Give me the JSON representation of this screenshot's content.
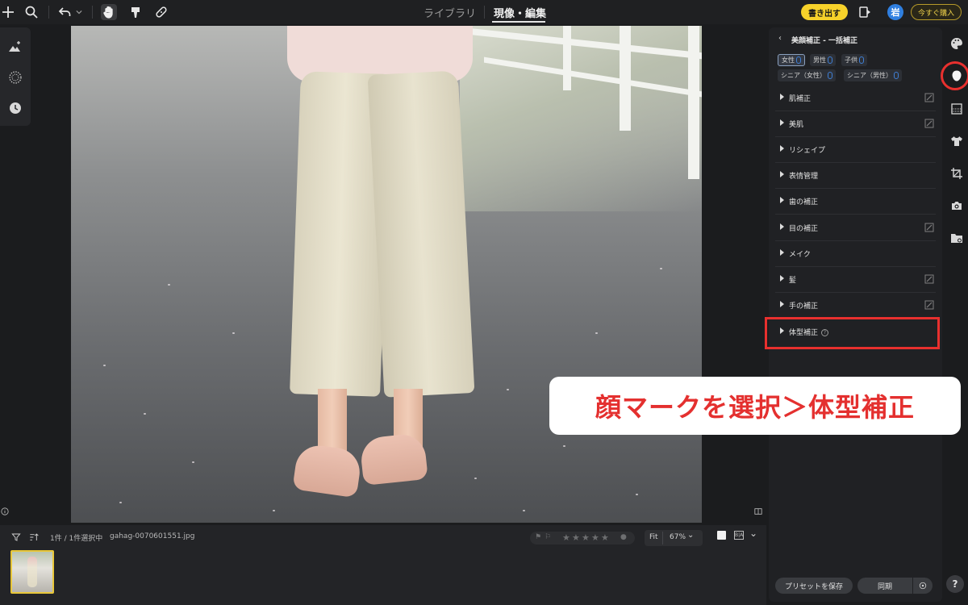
{
  "header": {
    "tabs": [
      {
        "label": "ライブラリ",
        "active": false
      },
      {
        "label": "現像・編集",
        "active": true
      }
    ],
    "export_label": "書き出す",
    "avatar_initial": "岩",
    "buy_label": "今すぐ購入"
  },
  "left_tools": [
    "mountain-adjust-icon",
    "noise-reduction-icon",
    "history-icon"
  ],
  "right_rail_icons": [
    "palette-icon",
    "face-icon",
    "gradient-icon",
    "clothing-icon",
    "crop-icon",
    "camera-icon",
    "folder-icon"
  ],
  "panel": {
    "title": "美顔補正 - 一括補正",
    "chips": [
      {
        "label": "女性",
        "selected": true
      },
      {
        "label": "男性",
        "selected": false
      },
      {
        "label": "子供",
        "selected": false
      },
      {
        "label": "シニア（女性）",
        "selected": false
      },
      {
        "label": "シニア（男性）",
        "selected": false
      }
    ],
    "sections": [
      {
        "label": "肌補正",
        "editable": true
      },
      {
        "label": "美肌",
        "editable": true
      },
      {
        "label": "リシェイプ",
        "editable": false
      },
      {
        "label": "表情管理",
        "editable": false
      },
      {
        "label": "歯の補正",
        "editable": false
      },
      {
        "label": "目の補正",
        "editable": true
      },
      {
        "label": "メイク",
        "editable": false
      },
      {
        "label": "髪",
        "editable": true
      },
      {
        "label": "手の補正",
        "editable": true
      },
      {
        "label": "体型補正",
        "editable": false,
        "help": true
      }
    ],
    "save_preset_label": "プリセットを保存",
    "sync_label": "同期"
  },
  "filmstrip": {
    "selection_count": "1件 / 1件選択中",
    "filename": "gahag-0070601551.jpg",
    "fit_label": "Fit",
    "zoom": "67%",
    "rating": 0
  },
  "annotation": {
    "callout_text": "顔マークを選択＞体型補正"
  },
  "colors": {
    "accent_yellow": "#f7d22a",
    "highlight_red": "#e8302e",
    "avatar_blue": "#2f7fe0"
  }
}
